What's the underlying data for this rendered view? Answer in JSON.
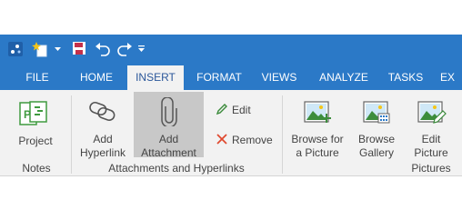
{
  "quick_access": {
    "icons": [
      "app-icon",
      "new-item-icon",
      "dropdown-arrow-icon",
      "save-icon",
      "undo-icon",
      "redo-icon",
      "customize-qat-icon"
    ]
  },
  "tabs": [
    {
      "label": "FILE"
    },
    {
      "label": "HOME"
    },
    {
      "label": "INSERT"
    },
    {
      "label": "FORMAT"
    },
    {
      "label": "VIEWS"
    },
    {
      "label": "ANALYZE"
    },
    {
      "label": "TASKS"
    },
    {
      "label": "EX"
    }
  ],
  "active_tab": "INSERT",
  "ribbon": {
    "notes": {
      "group_label": "Notes",
      "project": {
        "label": "Project"
      }
    },
    "attachments": {
      "group_label": "Attachments and Hyperlinks",
      "add_hyperlink": {
        "line1": "Add",
        "line2": "Hyperlink"
      },
      "add_attachment": {
        "line1": "Add",
        "line2": "Attachment"
      },
      "edit": {
        "label": "Edit"
      },
      "remove": {
        "label": "Remove"
      }
    },
    "pictures": {
      "group_label": "Pictures",
      "browse_picture": {
        "line1": "Browse for",
        "line2": "a Picture"
      },
      "browse_gallery": {
        "line1": "Browse",
        "line2": "Gallery"
      },
      "edit_picture": {
        "line1": "Edit",
        "line2": "Picture"
      }
    }
  },
  "colors": {
    "title_bar": "#2b79c7",
    "ribbon_bg": "#f2f2f2",
    "active_tab_text": "#2b579a",
    "hover_highlight": "#c8c8c8",
    "remove_x": "#e04a2f",
    "project_green": "#3f9a3f"
  }
}
